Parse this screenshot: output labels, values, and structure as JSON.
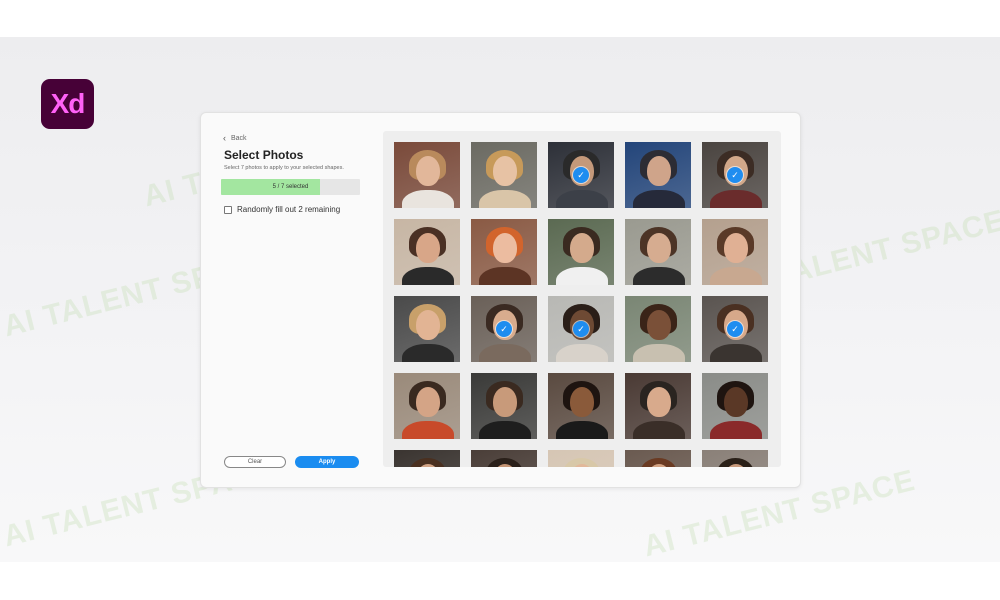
{
  "app": {
    "logo_text": "Xd",
    "logo_bg": "#470137",
    "logo_fg": "#ff61f6"
  },
  "watermark": {
    "text": "AI TALENT SPACE"
  },
  "dialog": {
    "back_label": "Back",
    "back_icon": "chevron-left-icon",
    "title": "Select Photos",
    "subtitle": "Select 7 photos to apply to your selected shapes.",
    "progress": {
      "text": "5 / 7 selected",
      "selected": 5,
      "total": 7,
      "fill_color": "#a3e6a0"
    },
    "random_fill_label": "Randomly fill out 2 remaining",
    "random_fill_checked": false,
    "clear_label": "Clear",
    "apply_label": "Apply",
    "accent": "#1a8cf0"
  },
  "photos": [
    {
      "bg": "#7a4a3a",
      "skin": "#e2b79a",
      "hair": "#b98a5c",
      "shirt": "#e9e4de",
      "selected": false
    },
    {
      "bg": "#6b6a62",
      "skin": "#e7c2a4",
      "hair": "#c79a5a",
      "shirt": "#d9c5a8",
      "selected": false
    },
    {
      "bg": "#2d3038",
      "skin": "#c4997a",
      "hair": "#2a2a2a",
      "shirt": "#3c4048",
      "selected": true
    },
    {
      "bg": "#23457a",
      "skin": "#cfa48a",
      "hair": "#2c2c34",
      "shirt": "#262a3a",
      "selected": false
    },
    {
      "bg": "#4a4440",
      "skin": "#d2a88a",
      "hair": "#3c2c24",
      "shirt": "#6a2c2c",
      "selected": true
    },
    {
      "bg": "#c7b6a4",
      "skin": "#d8a688",
      "hair": "#4a3024",
      "shirt": "#2a2a2a",
      "selected": false
    },
    {
      "bg": "#8a5a44",
      "skin": "#ecbca0",
      "hair": "#d2642c",
      "shirt": "#5c3424",
      "selected": false
    },
    {
      "bg": "#5b6a52",
      "skin": "#d4aa8c",
      "hair": "#3a2a20",
      "shirt": "#f0f0f0",
      "selected": false
    },
    {
      "bg": "#9a9a90",
      "skin": "#d6ac90",
      "hair": "#4c3426",
      "shirt": "#2c2c2c",
      "selected": false
    },
    {
      "bg": "#b4a08e",
      "skin": "#e0b094",
      "hair": "#5a3a28",
      "shirt": "#c8a890",
      "selected": false
    },
    {
      "bg": "#4a4a4a",
      "skin": "#e2b494",
      "hair": "#c8a06a",
      "shirt": "#2a2a2a",
      "selected": false
    },
    {
      "bg": "#6a6058",
      "skin": "#d8ac8e",
      "hair": "#3a2a22",
      "shirt": "#7a6a5e",
      "selected": true
    },
    {
      "bg": "#b8b8b4",
      "skin": "#6e4a34",
      "hair": "#2a1e18",
      "shirt": "#d8d2ca",
      "selected": true
    },
    {
      "bg": "#7a8674",
      "skin": "#7a5038",
      "hair": "#3a2418",
      "shirt": "#c8c0b0",
      "selected": false
    },
    {
      "bg": "#5a5450",
      "skin": "#d6a88a",
      "hair": "#4a3022",
      "shirt": "#3a3430",
      "selected": true
    },
    {
      "bg": "#9a8a7a",
      "skin": "#d4a486",
      "hair": "#3a2a20",
      "shirt": "#c84a2a",
      "selected": false
    },
    {
      "bg": "#3a3a38",
      "skin": "#c89a7a",
      "hair": "#3a2a20",
      "shirt": "#1e1e1e",
      "selected": false
    },
    {
      "bg": "#5a4a40",
      "skin": "#8a5a3a",
      "hair": "#1e1410",
      "shirt": "#1a1a1a",
      "selected": false
    },
    {
      "bg": "#4a3a34",
      "skin": "#d8aa8c",
      "hair": "#2a2420",
      "shirt": "#3a2e28",
      "selected": false
    },
    {
      "bg": "#8a8c88",
      "skin": "#5a3826",
      "hair": "#1e1410",
      "shirt": "#8a2a2a",
      "selected": false
    },
    {
      "bg": "#3a3430",
      "skin": "#d2a486",
      "hair": "#4a3020",
      "shirt": "#2a2a2a",
      "selected": false
    },
    {
      "bg": "#4a3e38",
      "skin": "#c49474",
      "hair": "#2a201a",
      "shirt": "#2a2a2a",
      "selected": false
    },
    {
      "bg": "#d6c6b4",
      "skin": "#e2b89a",
      "hair": "#d8c8a8",
      "shirt": "#eaeaea",
      "selected": false
    },
    {
      "bg": "#6a5a50",
      "skin": "#d2a282",
      "hair": "#6a3a22",
      "shirt": "#3a3a3a",
      "selected": false
    },
    {
      "bg": "#8a8078",
      "skin": "#c89a7c",
      "hair": "#2a2018",
      "shirt": "#5a4a40",
      "selected": false
    }
  ]
}
